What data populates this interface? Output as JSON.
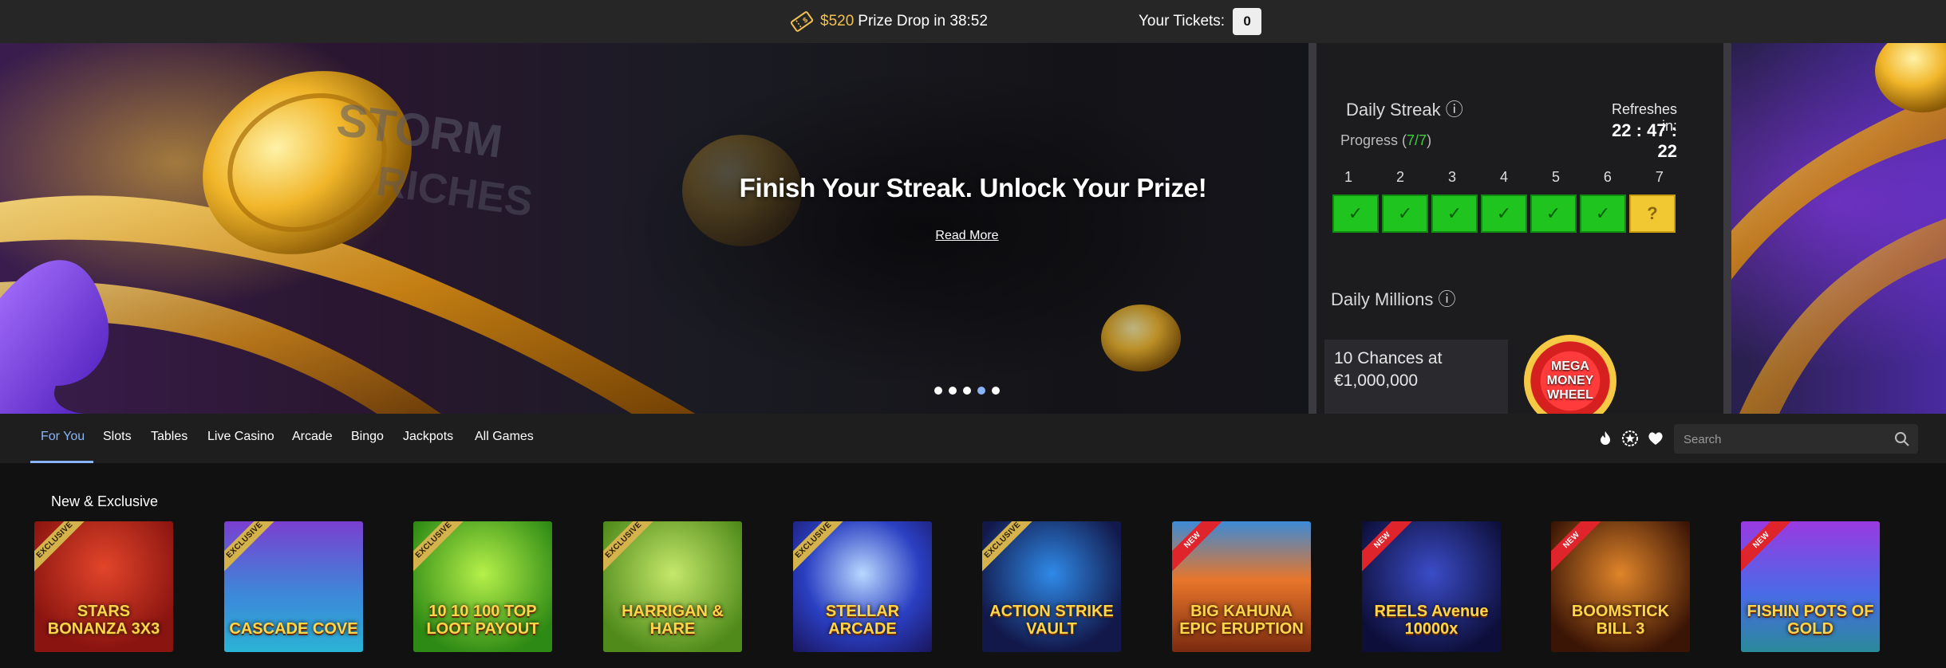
{
  "promo_bar": {
    "prize_amount": "$520",
    "prize_text": "Prize Drop in 38:52",
    "tickets_label": "Your Tickets:",
    "tickets_count": "0"
  },
  "hero": {
    "title": "Finish Your Streak. Unlock Your Prize!",
    "link": "Read More",
    "carousel_dots": 5,
    "active_dot": 4,
    "phone": {
      "daily_streak": "Daily Streak",
      "progress_label": "Progress (",
      "progress_value": "7/7",
      "progress_close": ")",
      "refreshes_in": "Refreshes in:",
      "timer": "22 : 47 : 22",
      "days": [
        "1",
        "2",
        "3",
        "4",
        "5",
        "6",
        "7"
      ],
      "daily_millions": "Daily Millions",
      "chances_line1": "10 Chances at",
      "chances_line2": "€1,000,000",
      "wheel_line1": "MEGA",
      "wheel_line2": "MONEY",
      "wheel_line3": "WHEEL"
    }
  },
  "nav": {
    "tabs": [
      "For You",
      "Slots",
      "Tables",
      "Live Casino",
      "Arcade",
      "Bingo",
      "Jackpots",
      "All Games"
    ],
    "active_tab": "For You",
    "icons": [
      "flame-icon",
      "star-badge-icon",
      "heart-icon"
    ],
    "search_placeholder": "Search"
  },
  "section": {
    "title": "New & Exclusive",
    "games": [
      {
        "name": "STARS BONANZA 3X3",
        "badge": "EXCLUSIVE"
      },
      {
        "name": "CASCADE COVE",
        "badge": "EXCLUSIVE"
      },
      {
        "name": "10 10 100 TOP LOOT PAYOUT",
        "badge": "EXCLUSIVE"
      },
      {
        "name": "HARRIGAN & HARE",
        "badge": "EXCLUSIVE"
      },
      {
        "name": "STELLAR ARCADE",
        "badge": "EXCLUSIVE"
      },
      {
        "name": "ACTION STRIKE VAULT",
        "badge": "EXCLUSIVE"
      },
      {
        "name": "BIG KAHUNA EPIC ERUPTION",
        "badge": "NEW"
      },
      {
        "name": "REELS Avenue 10000x",
        "badge": "NEW"
      },
      {
        "name": "BOOMSTICK BILL 3",
        "badge": "NEW"
      },
      {
        "name": "FISHIN POTS OF GOLD",
        "badge": "NEW"
      }
    ]
  },
  "colors": {
    "accent": "#8ab4f8",
    "gold": "#f2c14e",
    "exclusive_ribbon": "#d4b24c",
    "new_ribbon": "#e0242b"
  }
}
